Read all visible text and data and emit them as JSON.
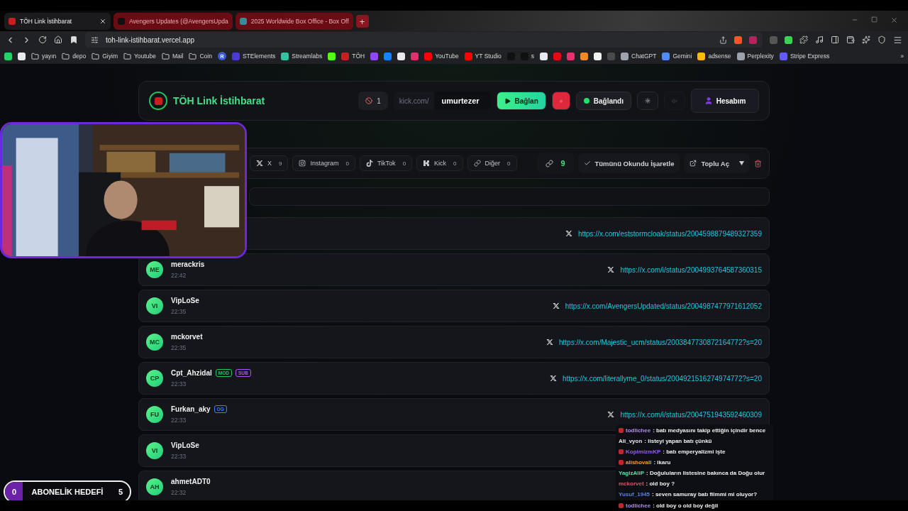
{
  "browser": {
    "tabs": [
      {
        "title": "TÖH Link İstihbarat",
        "selected": true
      },
      {
        "title": "Avengers Updates (@AvengersUpda",
        "selected": false
      },
      {
        "title": "2025 Worldwide Box Office - Box Off",
        "selected": false
      }
    ],
    "new_tab": "+",
    "address": "toh-link-istihbarat.vercel.app",
    "bookmarks": [
      {
        "kind": "site",
        "color": "#25d366"
      },
      {
        "kind": "site",
        "color": "#e8eaed"
      },
      {
        "kind": "folder",
        "label": "yayın"
      },
      {
        "kind": "folder",
        "label": "depo"
      },
      {
        "kind": "folder",
        "label": "Giyim"
      },
      {
        "kind": "folder",
        "label": "Youtube"
      },
      {
        "kind": "folder",
        "label": "Mail"
      },
      {
        "kind": "folder",
        "label": "Coin"
      },
      {
        "kind": "letter",
        "label": "R",
        "color": "#3b5bdb"
      },
      {
        "kind": "site",
        "label": "STElements",
        "color": "#4c3bd1"
      },
      {
        "kind": "site",
        "label": "Streamlabs",
        "color": "#31c3a2"
      },
      {
        "kind": "site",
        "color": "#53fc18"
      },
      {
        "kind": "site",
        "label": "TÖH",
        "color": "#c81e1e"
      },
      {
        "kind": "site",
        "color": "#9146ff"
      },
      {
        "kind": "site",
        "color": "#1185fe"
      },
      {
        "kind": "site",
        "color": "#e8eaed"
      },
      {
        "kind": "site",
        "color": "#e1306c"
      },
      {
        "kind": "site",
        "label": "YouTube",
        "color": "#ff0000"
      },
      {
        "kind": "site",
        "label": "YT Studio",
        "color": "#ff0000"
      },
      {
        "kind": "site",
        "color": "#111111"
      },
      {
        "kind": "site",
        "label": "s",
        "color": "#111111"
      },
      {
        "kind": "site",
        "color": "#e8eaed"
      },
      {
        "kind": "site",
        "color": "#e50914"
      },
      {
        "kind": "site",
        "color": "#e6336e"
      },
      {
        "kind": "site",
        "color": "#f08a24"
      },
      {
        "kind": "site",
        "color": "#f2f2f2"
      },
      {
        "kind": "site",
        "color": "#4a4a4a"
      },
      {
        "kind": "site",
        "label": "ChatGPT",
        "color": "#9ca3af"
      },
      {
        "kind": "site",
        "label": "Gemini",
        "color": "#4f8cf7"
      },
      {
        "kind": "site",
        "label": "adsense",
        "color": "#fbbc04"
      },
      {
        "kind": "site",
        "label": "Perplexity",
        "color": "#9ca3af"
      },
      {
        "kind": "site",
        "label": "Stripe Express",
        "color": "#635bff"
      }
    ],
    "more": "»"
  },
  "header": {
    "title": "TÖH Link İstihbarat",
    "blocked_count": "1",
    "channel_prefix": "kick.com/",
    "channel": "umurtezer",
    "connect_button": "Bağlan",
    "status": "Bağlandı",
    "connected": true,
    "muted_disabled": true,
    "account_button": "Hesabım"
  },
  "filters": [
    {
      "kind": "x",
      "label": "X",
      "count": "9"
    },
    {
      "kind": "instagram",
      "label": "Instagram",
      "count": "0"
    },
    {
      "kind": "tiktok",
      "label": "TikTok",
      "count": "0"
    },
    {
      "kind": "kick",
      "label": "Kick",
      "count": "0"
    },
    {
      "kind": "other",
      "label": "Diğer",
      "count": "0"
    }
  ],
  "link_count": "9",
  "mark_all_read": "Tümünü Okundu İşaretle",
  "bulk_open": "Toplu Aç",
  "links": [
    {
      "link": "https://x.com/eststormcloak/status/2004598879489327359"
    },
    {
      "initials": "ME",
      "user": "merackris",
      "time": "22:42",
      "link": "https://x.com/i/status/2004993764587360315"
    },
    {
      "initials": "VI",
      "user": "VipLoSe",
      "time": "22:35",
      "link": "https://x.com/AvengersUpdated/status/2004987477971612052"
    },
    {
      "initials": "MC",
      "user": "mckorvet",
      "time": "22:35",
      "link": "https://x.com/Majestic_ucm/status/2003847730872164772?s=20"
    },
    {
      "initials": "CP",
      "user": "Cpt_Ahzidal",
      "time": "22:33",
      "badges": [
        {
          "label": "MOD",
          "color": "#22c55e"
        },
        {
          "label": "SUB",
          "color": "#a855f7"
        }
      ],
      "link": "https://x.com/literallyme_0/status/2004921516274974772?s=20"
    },
    {
      "initials": "FU",
      "user": "Furkan_aky",
      "time": "22:33",
      "badges": [
        {
          "label": "OG",
          "color": "#3b82f6"
        }
      ],
      "link": "https://x.com/i/status/2004751943592460309"
    },
    {
      "initials": "VI",
      "user": "VipLoSe",
      "time": "22:33"
    },
    {
      "initials": "AH",
      "user": "ahmetADT0",
      "time": "22:32"
    }
  ],
  "goal": {
    "current": "0",
    "label": "ABONELİK HEDEFİ",
    "target": "5",
    "level": 0.05
  },
  "chat": [
    {
      "user": "todlichee",
      "text": ": batı medyasını takip ettiğin içindir bence",
      "color": "#b48cf0",
      "badge": true
    },
    {
      "user": "Ali_vyon",
      "text": ": listeyi yapan batı çünkü",
      "color": "#e5e7eb",
      "badge": false
    },
    {
      "user": "KopimizmKP",
      "text": ": batı emperyalizmi işte",
      "color": "#9b5de5",
      "badge": true
    },
    {
      "user": "alishovali",
      "text": ": ikaru",
      "color": "#f0a030",
      "badge": true
    },
    {
      "user": "YagizAliP",
      "text": ": Doğuluların listesine bakınca da Doğu olur",
      "color": "#5ee0a8",
      "badge": false
    },
    {
      "user": "mckorvet",
      "text": ": old boy ?",
      "color": "#e0506a",
      "badge": false
    },
    {
      "user": "Yusuf_1945",
      "text": ": seven samuray batı filmmi mi oluyor?",
      "color": "#5b7fe0",
      "badge": false
    },
    {
      "user": "todlichee",
      "text": ": old boy o old boy değil",
      "color": "#b48cf0",
      "badge": true
    }
  ]
}
